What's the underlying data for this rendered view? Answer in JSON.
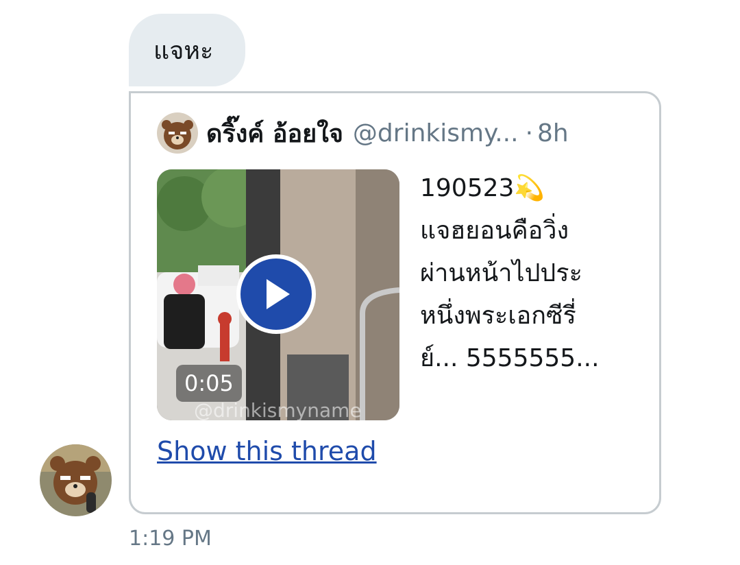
{
  "message": {
    "text": "แจหะ",
    "time": "1:19 PM"
  },
  "tweet": {
    "author_name": "ดริ๊งค์ อ้อยใจ",
    "author_handle": "@drinkismy...",
    "separator": "·",
    "relative_time": "8h",
    "text": "190523💫\nแจฮยอนคือวิ่ง\nผ่านหน้าไปประ\nหนึ่งพระเอกซีรี่\nย์... 5555555...",
    "media": {
      "duration": "0:05",
      "watermark": "@drinkismyname",
      "play_icon": "play-icon"
    },
    "show_thread_label": "Show this thread"
  },
  "icons": {
    "author_avatar": "brown-bear-avatar",
    "sender_avatar": "brown-bear-avatar"
  },
  "colors": {
    "bubble_bg": "#e6ecf0",
    "link": "#1f4bab",
    "play_button": "#1f4bab",
    "muted_text": "#657786",
    "card_border": "#c6ccd0"
  }
}
